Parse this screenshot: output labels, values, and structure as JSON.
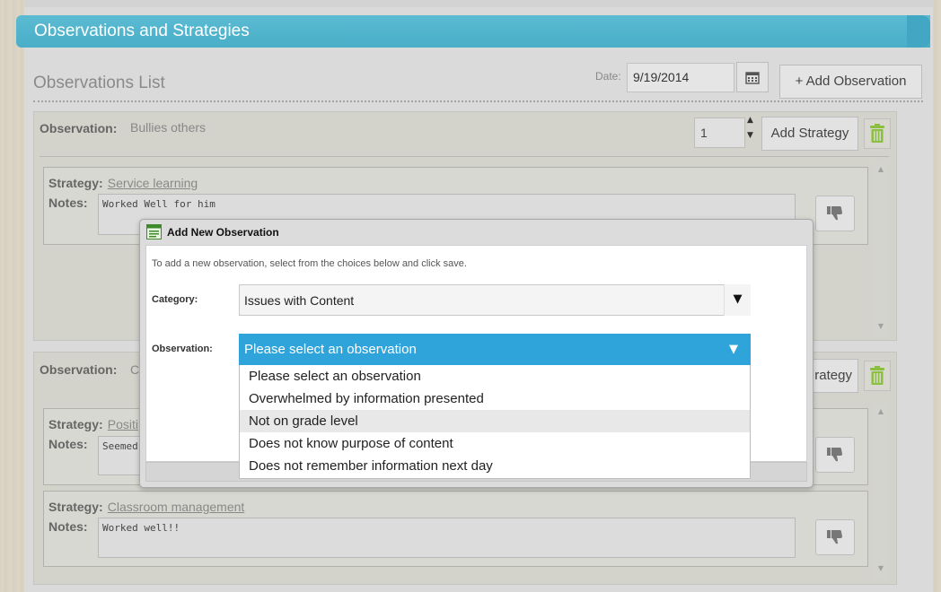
{
  "header": {
    "title": "Observations and Strategies"
  },
  "list": {
    "title": "Observations List",
    "date_label": "Date:",
    "date_value": "9/19/2014",
    "add_observation_label": "+ Add Observation"
  },
  "observations": [
    {
      "label": "Observation:",
      "value": "Bullies others",
      "count": "1",
      "add_strategy_label": "Add Strategy",
      "strategies": [
        {
          "label": "Strategy:",
          "name": "Service learning",
          "notes_label": "Notes:",
          "notes": "Worked Well for him"
        }
      ]
    },
    {
      "label": "Observation:",
      "value": "C",
      "add_strategy_label": "rategy",
      "strategies": [
        {
          "label": "Strategy:",
          "name": "Positi",
          "notes_label": "Notes:",
          "notes": "Seemed"
        },
        {
          "label": "Strategy:",
          "name": "Classroom management",
          "notes_label": "Notes:",
          "notes": "Worked well!!"
        }
      ]
    }
  ],
  "modal": {
    "title": "Add New Observation",
    "instructions": "To add a new observation, select from the choices below and click save.",
    "category_label": "Category:",
    "category_value": "Issues with Content",
    "observation_label": "Observation:",
    "observation_value": "Please select an observation",
    "options": [
      "Please select an observation",
      "Overwhelmed by information presented",
      "Not on grade level",
      "Does not know purpose of content",
      "Does not remember information next day"
    ],
    "highlighted_index": 2
  },
  "icons": {
    "calendar": "calendar-icon",
    "trash": "trash-icon",
    "thumbs_down": "thumbs-down-icon",
    "modal": "form-icon"
  },
  "colors": {
    "header": "#49aec8",
    "select_active": "#2fa4da",
    "trash": "#8bbf3f"
  }
}
